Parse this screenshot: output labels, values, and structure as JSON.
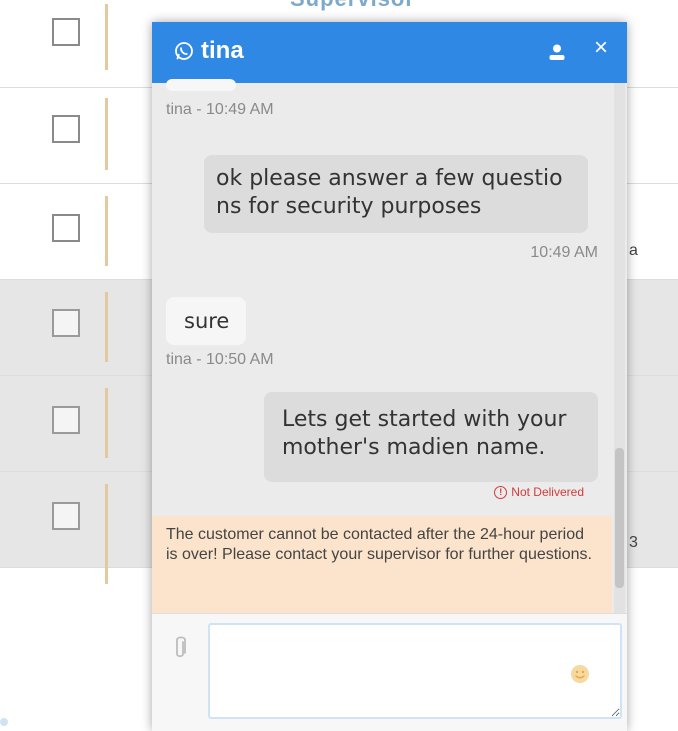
{
  "background_table": {
    "header_label": "Supervisor",
    "edge_glyphs": [
      "a",
      "3"
    ]
  },
  "chat": {
    "title": "tina",
    "close_label": "×",
    "messages": [
      {
        "direction": "in",
        "meta": "tina - 10:49 AM"
      },
      {
        "direction": "out",
        "text": "ok please answer a few questio ns for security purposes",
        "time": "10:49 AM"
      },
      {
        "direction": "in",
        "text": "sure",
        "meta": "tina - 10:50 AM"
      },
      {
        "direction": "out",
        "text": "Lets get started with your mother's madien name.",
        "status": "Not Delivered"
      }
    ],
    "status_icon": "!",
    "warning": "The customer cannot be contacted after the 24-hour period is over! Please contact your supervisor for further questions.",
    "composer": {
      "placeholder": "",
      "value": ""
    },
    "icons": {
      "header_left": "whatsapp-icon",
      "header_right": "user-icon",
      "attach": "paperclip-icon",
      "emoji": "emoji-icon",
      "status": "alert-circle-icon"
    },
    "colors": {
      "header": "#2f88e3",
      "warning_bg": "#fce4cc",
      "error": "#d23a3a",
      "outgoing_bubble": "#dcdcdc",
      "incoming_bubble": "#f6f6f6"
    }
  }
}
